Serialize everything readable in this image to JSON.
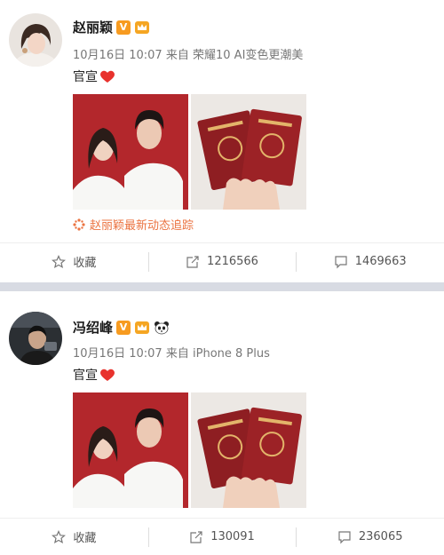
{
  "posts": [
    {
      "username": "赵丽颖",
      "verified_badge": "V",
      "icons": [
        "crown-badge-icon"
      ],
      "date": "10月16日",
      "time": "10:07",
      "source_prefix": "来自",
      "source": "荣耀10 AI变色更潮美",
      "text": "官宣",
      "follow_link": "赵丽颖最新动态追踪",
      "actions": {
        "favorite": "收藏",
        "repost": "1216566",
        "comment": "1469663"
      }
    },
    {
      "username": "冯绍峰",
      "verified_badge": "V",
      "icons": [
        "crown-badge-icon",
        "panda-icon"
      ],
      "date": "10月16日",
      "time": "10:07",
      "source_prefix": "来自",
      "source": "iPhone 8 Plus",
      "text": "官宣",
      "actions": {
        "favorite": "收藏",
        "repost": "130091",
        "comment": "236065"
      }
    }
  ],
  "colors": {
    "accent_orange": "#eb7340",
    "badge_orange": "#f79b20",
    "heart_red": "#e8322d",
    "separator": "#d8dbe3"
  }
}
